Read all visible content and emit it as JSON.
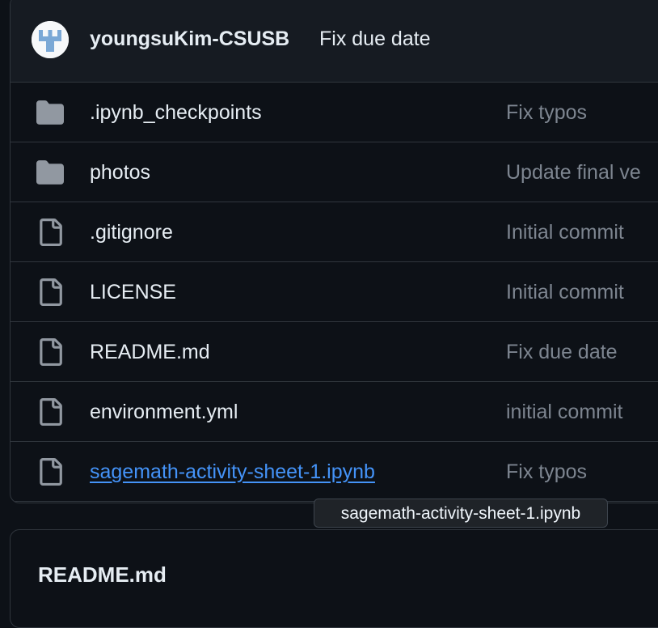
{
  "commit": {
    "author": "youngsuKim-CSUSB",
    "message": "Fix due date",
    "avatar_icon": "identicon-avatar"
  },
  "files": [
    {
      "name": ".ipynb_checkpoints",
      "type": "folder",
      "icon": "folder-icon",
      "message": "Fix typos"
    },
    {
      "name": "photos",
      "type": "folder",
      "icon": "folder-icon",
      "message": "Update final ve"
    },
    {
      "name": ".gitignore",
      "type": "file",
      "icon": "file-icon",
      "message": "Initial commit"
    },
    {
      "name": "LICENSE",
      "type": "file",
      "icon": "file-icon",
      "message": "Initial commit"
    },
    {
      "name": "README.md",
      "type": "file",
      "icon": "file-icon",
      "message": "Fix due date"
    },
    {
      "name": "environment.yml",
      "type": "file",
      "icon": "file-icon",
      "message": "initial commit"
    },
    {
      "name": "sagemath-activity-sheet-1.ipynb",
      "type": "file",
      "icon": "file-icon",
      "message": "Fix typos",
      "hovered": true
    }
  ],
  "tooltip": "sagemath-activity-sheet-1.ipynb",
  "readme": {
    "title": "README.md"
  },
  "colors": {
    "background": "#0d1117",
    "header_bg": "#161b22",
    "border": "#30363d",
    "link": "#4493f8",
    "muted": "#7d8590",
    "icon": "#9198a1"
  }
}
